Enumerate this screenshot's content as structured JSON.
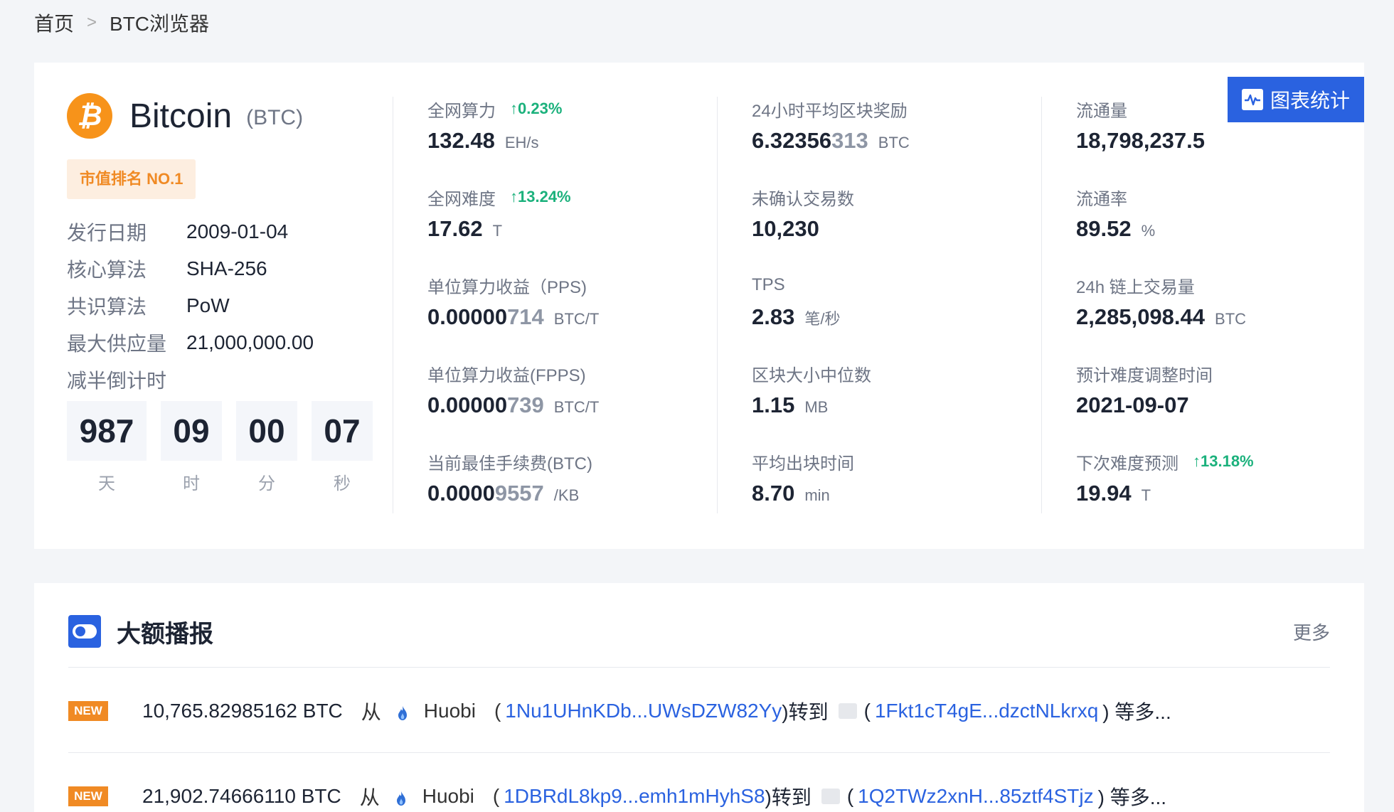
{
  "breadcrumb": {
    "home": "首页",
    "separator": ">",
    "current": "BTC浏览器"
  },
  "chart_button": {
    "label": "图表统计",
    "icon": "pulse-icon"
  },
  "coin": {
    "name": "Bitcoin",
    "symbol": "(BTC)",
    "logo_char": "₿",
    "rank": "市值排名 NO.1",
    "info": [
      {
        "key": "发行日期",
        "value": "2009-01-04"
      },
      {
        "key": "核心算法",
        "value": "SHA-256"
      },
      {
        "key": "共识算法",
        "value": "PoW"
      },
      {
        "key": "最大供应量",
        "value": "21,000,000.00"
      },
      {
        "key": "减半倒计时",
        "value": ""
      }
    ],
    "countdown": [
      {
        "value": "987",
        "unit": "天"
      },
      {
        "value": "09",
        "unit": "时"
      },
      {
        "value": "00",
        "unit": "分"
      },
      {
        "value": "07",
        "unit": "秒"
      }
    ]
  },
  "stats_col1": [
    {
      "label": "全网算力",
      "change": "↑0.23%",
      "value": "132.48",
      "value_dim": "",
      "unit": "EH/s"
    },
    {
      "label": "全网难度",
      "change": "↑13.24%",
      "value": "17.62",
      "value_dim": "",
      "unit": "T"
    },
    {
      "label": "单位算力收益（PPS)",
      "change": "",
      "value": "0.00000",
      "value_dim": "714",
      "unit": "BTC/T"
    },
    {
      "label": "单位算力收益(FPPS)",
      "change": "",
      "value": "0.00000",
      "value_dim": "739",
      "unit": "BTC/T"
    },
    {
      "label": "当前最佳手续费(BTC)",
      "change": "",
      "value": "0.0000",
      "value_dim": "9557",
      "unit": "/KB"
    }
  ],
  "stats_col2": [
    {
      "label": "24小时平均区块奖励",
      "change": "",
      "value": "6.32356",
      "value_dim": "313",
      "unit": "BTC"
    },
    {
      "label": "未确认交易数",
      "change": "",
      "value": "10,230",
      "value_dim": "",
      "unit": ""
    },
    {
      "label": "TPS",
      "change": "",
      "value": "2.83",
      "value_dim": "",
      "unit": "笔/秒"
    },
    {
      "label": "区块大小中位数",
      "change": "",
      "value": "1.15",
      "value_dim": "",
      "unit": "MB"
    },
    {
      "label": "平均出块时间",
      "change": "",
      "value": "8.70",
      "value_dim": "",
      "unit": "min"
    }
  ],
  "stats_col3": [
    {
      "label": "流通量",
      "change": "",
      "value": "18,798,237.5",
      "value_dim": "",
      "unit": ""
    },
    {
      "label": "流通率",
      "change": "",
      "value": "89.52",
      "value_dim": "",
      "unit": "%"
    },
    {
      "label": "24h 链上交易量",
      "change": "",
      "value": "2,285,098.44",
      "value_dim": "",
      "unit": "BTC"
    },
    {
      "label": "预计难度调整时间",
      "change": "",
      "value": "2021-09-07",
      "value_dim": "",
      "unit": ""
    },
    {
      "label": "下次难度预测",
      "change": "↑13.18%",
      "value": "19.94",
      "value_dim": "",
      "unit": "T"
    }
  ],
  "whale": {
    "title": "大额播报",
    "more": "更多",
    "rows": [
      {
        "badge": "NEW",
        "amount": "10,765.82985162 BTC",
        "from_word": "从",
        "exchange": "Huobi",
        "open_paren": "(",
        "from_addr": "1Nu1UHnKDb...UWsDZW82Yy",
        "to_word": ")转到",
        "to_addr": "1Fkt1cT4gE...dzctNLkrxq",
        "tail": ") 等多..."
      },
      {
        "badge": "NEW",
        "amount": "21,902.74666110 BTC",
        "from_word": "从",
        "exchange": "Huobi",
        "open_paren": "(",
        "from_addr": "1DBRdL8kp9...emh1mHyhS8",
        "to_word": ")转到",
        "to_addr": "1Q2TWz2xnH...85ztf4STjz",
        "tail": ") 等多..."
      }
    ]
  },
  "colors": {
    "accent": "#2a62e0",
    "up": "#1bb17c",
    "btc": "#f7931a",
    "badge": "#f08a24"
  }
}
